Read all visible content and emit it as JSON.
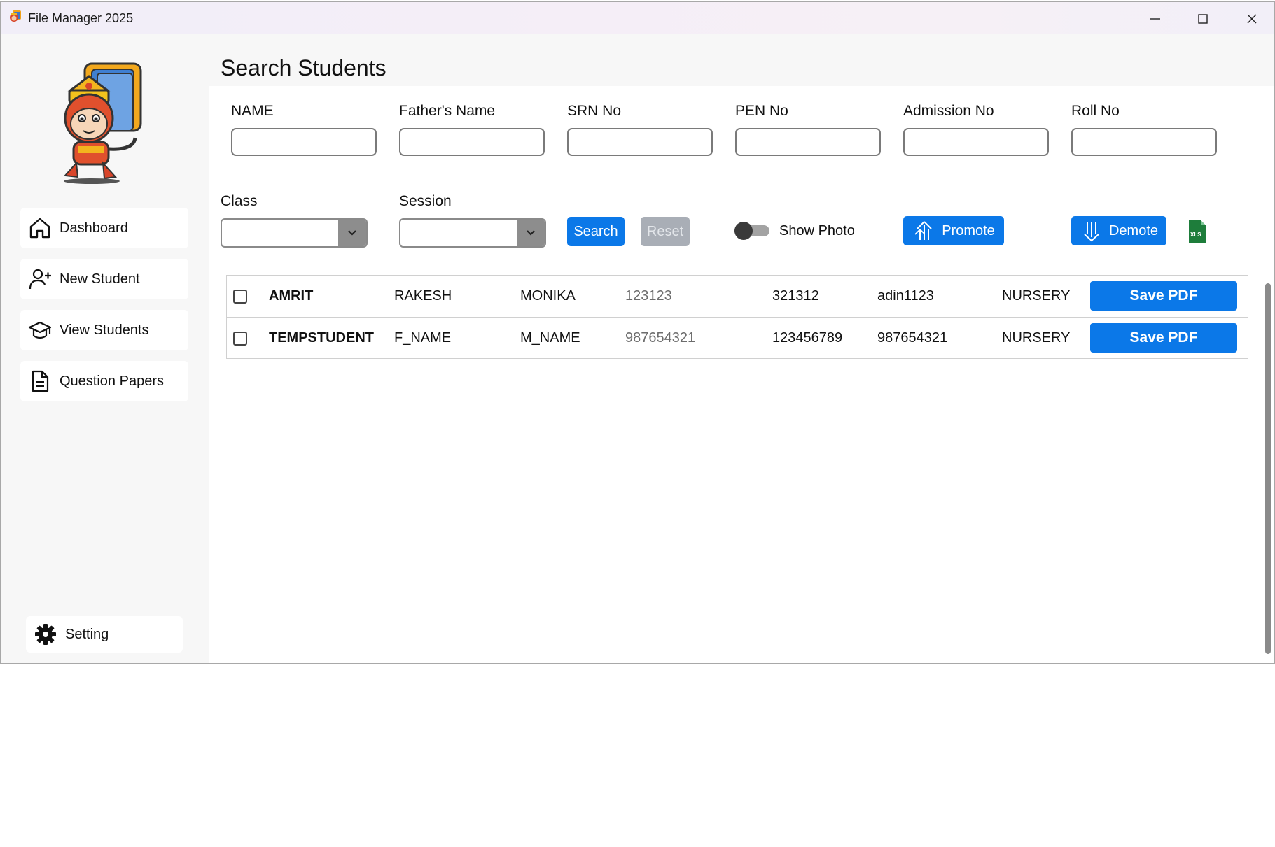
{
  "window": {
    "title": "File Manager 2025"
  },
  "sidebar": {
    "items": [
      {
        "label": "Dashboard",
        "icon": "home-icon"
      },
      {
        "label": "New Student",
        "icon": "add-user-icon"
      },
      {
        "label": "View Students",
        "icon": "graduation-cap-icon"
      },
      {
        "label": "Question Papers",
        "icon": "document-icon"
      }
    ],
    "setting": {
      "label": "Setting",
      "icon": "gear-icon"
    }
  },
  "page": {
    "title": "Search Students"
  },
  "filters": {
    "name": {
      "label": "NAME",
      "value": ""
    },
    "father": {
      "label": "Father's Name",
      "value": ""
    },
    "srn": {
      "label": "SRN No",
      "value": ""
    },
    "pen": {
      "label": "PEN No",
      "value": ""
    },
    "admission": {
      "label": "Admission No",
      "value": ""
    },
    "roll": {
      "label": "Roll No",
      "value": ""
    },
    "class": {
      "label": "Class",
      "value": ""
    },
    "session": {
      "label": "Session",
      "value": ""
    }
  },
  "actions": {
    "search": "Search",
    "reset": "Reset",
    "show_photo": "Show Photo",
    "show_photo_on": false,
    "promote": "Promote",
    "demote": "Demote",
    "xls": "XLS"
  },
  "students": [
    {
      "name": "AMRIT",
      "father": "RAKESH",
      "mother": "MONIKA",
      "srn": "123123",
      "pen": "321312",
      "admission": "adin1123",
      "class": "NURSERY",
      "button": "Save PDF"
    },
    {
      "name": "TEMPSTUDENT",
      "father": "F_NAME",
      "mother": "M_NAME",
      "srn": "987654321",
      "pen": "123456789",
      "admission": "987654321",
      "class": "NURSERY",
      "button": "Save PDF"
    }
  ],
  "colors": {
    "accent": "#0b78e8",
    "disabled": "#a9aeb6",
    "sidebar_bg": "#f7f7f7",
    "excel_green": "#1e7d3b"
  }
}
